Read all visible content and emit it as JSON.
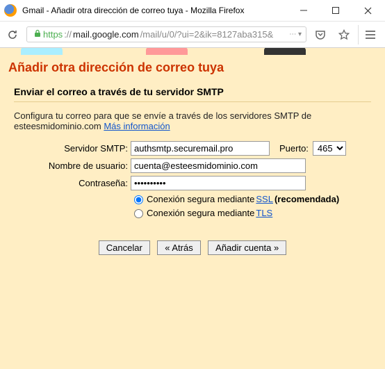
{
  "window": {
    "title": "Gmail - Añadir otra dirección de correo tuya - Mozilla Firefox"
  },
  "address": {
    "scheme": "https",
    "host": "mail.google.com",
    "path_display": "://",
    "rest": "/mail/u/0/?ui=2&ik=8127aba315&"
  },
  "page_header": "Añadir otra dirección de correo tuya",
  "sub_header": "Enviar el correo a través de tu servidor SMTP",
  "intro": {
    "text": "Configura tu correo para que se envíe a través de los servidores SMTP de esteesmidominio.com ",
    "link": "Más información"
  },
  "form": {
    "smtp_label": "Servidor SMTP:",
    "smtp_value": "authsmtp.securemail.pro",
    "port_label": "Puerto:",
    "port_value": "465",
    "user_label": "Nombre de usuario:",
    "user_value": "cuenta@esteesmidominio.com",
    "pass_label": "Contraseña:",
    "pass_value": "••••••••••",
    "ssl_prefix": "Conexión segura mediante ",
    "ssl_link": "SSL",
    "ssl_suffix": " (recomendada)",
    "tls_prefix": "Conexión segura mediante ",
    "tls_link": "TLS"
  },
  "buttons": {
    "cancel": "Cancelar",
    "back": "« Atrás",
    "add": "Añadir cuenta »"
  }
}
